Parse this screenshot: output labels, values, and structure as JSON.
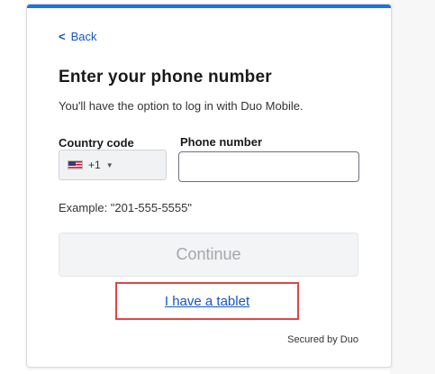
{
  "nav": {
    "back_label": "Back",
    "back_glyph": "<"
  },
  "header": {
    "title": "Enter your phone number",
    "subtitle": "You'll have the option to log in with Duo Mobile."
  },
  "form": {
    "country_code_label": "Country code",
    "phone_number_label": "Phone number",
    "country_code_value": "+1",
    "country_flag": "us-flag-icon",
    "phone_number_value": "",
    "example_text": "Example: \"201-555-5555\""
  },
  "actions": {
    "continue_label": "Continue",
    "tablet_link_label": "I have a tablet"
  },
  "footer": {
    "secured_text": "Secured by Duo"
  },
  "colors": {
    "accent_bar": "#1a73e8",
    "link": "#1656c3",
    "highlight_box": "#e0454a",
    "disabled_text": "#a3a7ad"
  }
}
